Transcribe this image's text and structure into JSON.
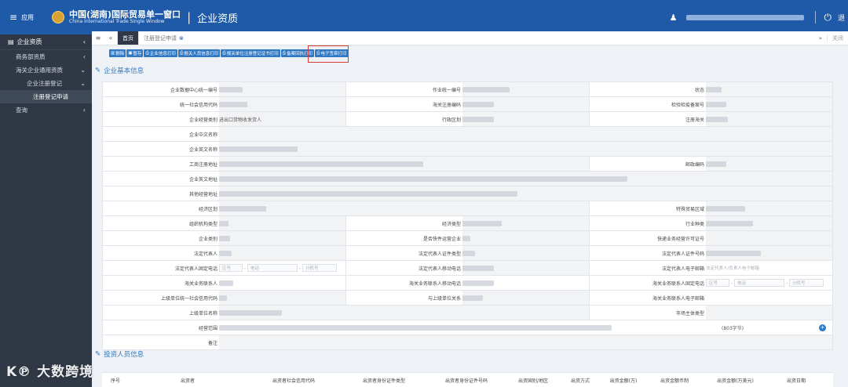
{
  "topbar": {
    "menu_label": "应用",
    "brand_cn": "中国(湖南)国际贸易单一窗口",
    "brand_en": "China International Trade Single Window",
    "module": "企业资质",
    "exit": "退"
  },
  "sidebar": {
    "header": "企业资质",
    "items": [
      {
        "label": "商务部资质",
        "level": 1,
        "arrow": "‹"
      },
      {
        "label": "海关企业通用资质",
        "level": 1,
        "arrow": "⌄"
      },
      {
        "label": "企业注册登记",
        "level": 2,
        "arrow": "⌄"
      },
      {
        "label": "注册登记申请",
        "level": 3,
        "arrow": ""
      },
      {
        "label": "查询",
        "level": 1,
        "arrow": "‹"
      }
    ]
  },
  "tabs": {
    "home": "首页",
    "current": "注册登记申请",
    "close_all": "关闭"
  },
  "toolbar": {
    "buttons": [
      "删除",
      "暂存",
      "企业信息打印",
      "报关人员信息打印",
      "报关单位注册登记证书打印",
      "备案回执打印",
      "电子签章打印"
    ],
    "highlighted": "备案回执打印"
  },
  "sections": {
    "basic": "企业基本信息",
    "investor": "投资人员信息"
  },
  "form": {
    "org_code_label": "企业数据中心统一编号",
    "op_no_label": "作业统一编号",
    "status_label": "状态",
    "credit_label": "统一社会信用代码",
    "customs_reg_label": "海关注册编码",
    "inspect_label": "检验检疫备案号",
    "biz_type_label": "企业经营类别",
    "biz_type_value": "进出口货物收发货人",
    "region_label": "行政区划",
    "reg_customs_label": "注册海关",
    "cn_name_label": "企业中文名称",
    "en_name_label": "企业英文名称",
    "reg_addr_label": "工商注册地址",
    "postcode_label": "邮政编码",
    "en_addr_label": "企业英文地址",
    "other_addr_label": "其他经营地址",
    "econ_zone_label": "经济区划",
    "special_zone_label": "特殊贸易区域",
    "org_type_label": "组织机构类型",
    "econ_type_label": "经济类型",
    "industry_label": "行业种类",
    "ent_cat_label": "企业类别",
    "cross_border_label": "是否快件运营企业",
    "express_label": "快递业务经营许可证号",
    "legal_rep_label": "法定代表人",
    "legal_id_type_label": "法定代表人证件类型",
    "legal_id_no_label": "法定代表人证件号码",
    "legal_tel_label": "法定代表人固定电话",
    "legal_mobile_label": "法定代表人移动电话",
    "legal_email_label": "法定代表人电子邮箱",
    "legal_email_hint": "法定代表人/负责人电子邮箱",
    "contact_label": "海关业务联系人",
    "contact_mobile_label": "海关业务联系人移动电话",
    "contact_tel_label": "海关业务联系人固定电话",
    "parent_credit_label": "上级单位统一社会信用代码",
    "parent_rel_label": "与上级单位关系",
    "contact_email_label": "海关业务联系人电子邮箱",
    "parent_name_label": "上级单位名称",
    "market_label": "市场主体类型",
    "scope_label": "经营范围",
    "scope_count": "(803字节)",
    "remark_label": "备注",
    "phone_area": "区号",
    "phone_tel": "电话",
    "phone_ext": "分机号",
    "plus": "+"
  },
  "investor_table": {
    "headers": [
      "序号",
      "出资者",
      "出资者社会信用代码",
      "出资者身份证件类型",
      "出资者身份证件号码",
      "出资国别/地区",
      "出资方式",
      "出资金额(万)",
      "出资金额币制",
      "出资金额(万美元)",
      "出资日期"
    ]
  },
  "watermark": "K℗ 大数跨境"
}
